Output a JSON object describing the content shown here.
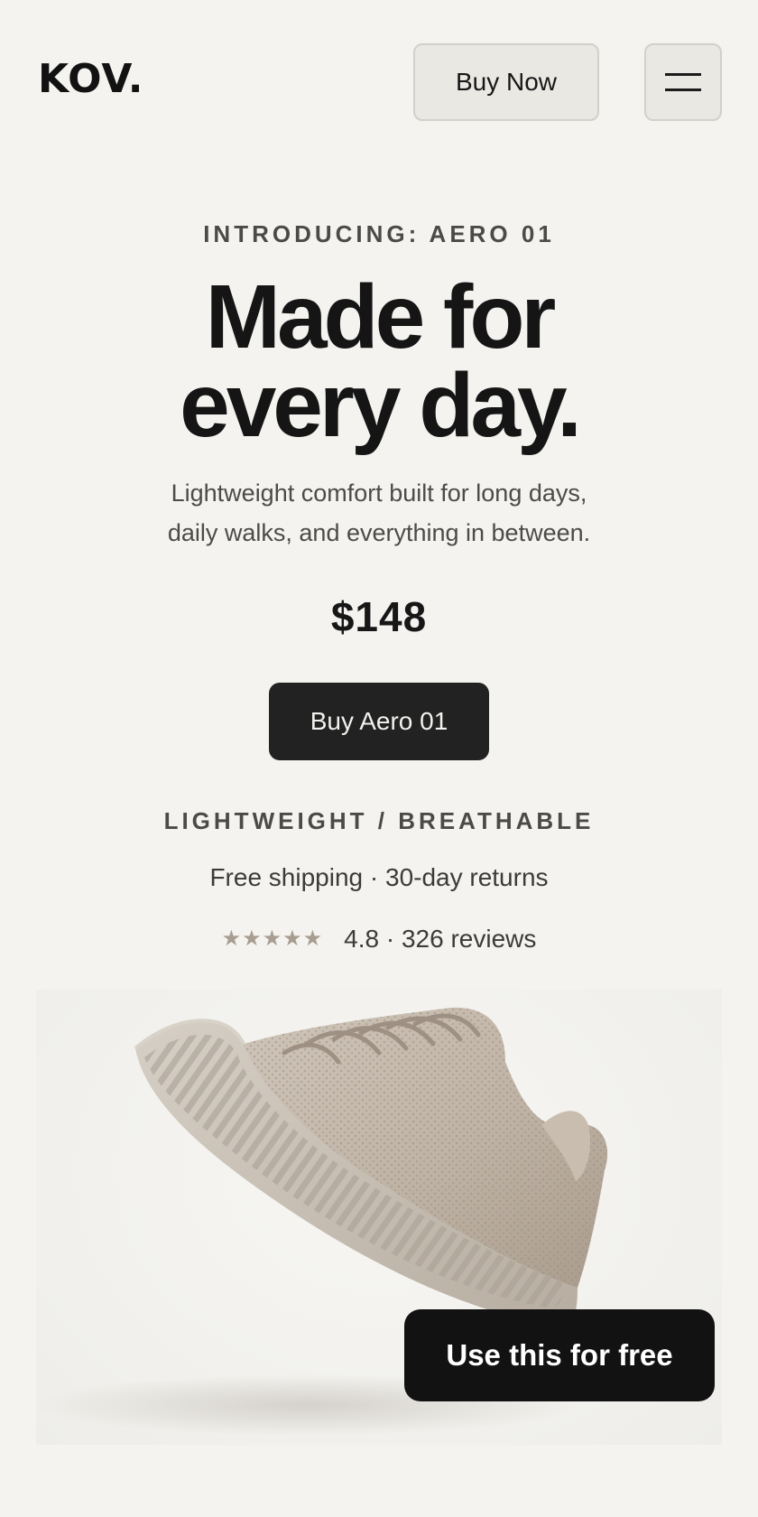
{
  "header": {
    "logo": "KOV.",
    "buy_now_label": "Buy Now",
    "menu_icon": "hamburger-menu-icon"
  },
  "hero": {
    "eyebrow": "INTRODUCING: AERO 01",
    "headline_line1": "Made for",
    "headline_line2": "every day.",
    "subtitle_line1": "Lightweight comfort built for long days,",
    "subtitle_line2": "daily walks, and everything in between.",
    "price": "$148",
    "cta_label": "Buy Aero 01",
    "features": "LIGHTWEIGHT / BREATHABLE",
    "shipping": "Free shipping · 30-day returns",
    "rating": {
      "stars": 5,
      "text": "4.8 · 326 reviews"
    }
  },
  "product_image": {
    "subject": "knit-sneaker-illustration"
  },
  "promo": {
    "label": "Use this for free"
  },
  "colors": {
    "background": "#f4f3ef",
    "cta": "#222222",
    "star": "#a89d91",
    "promo": "#121212"
  }
}
